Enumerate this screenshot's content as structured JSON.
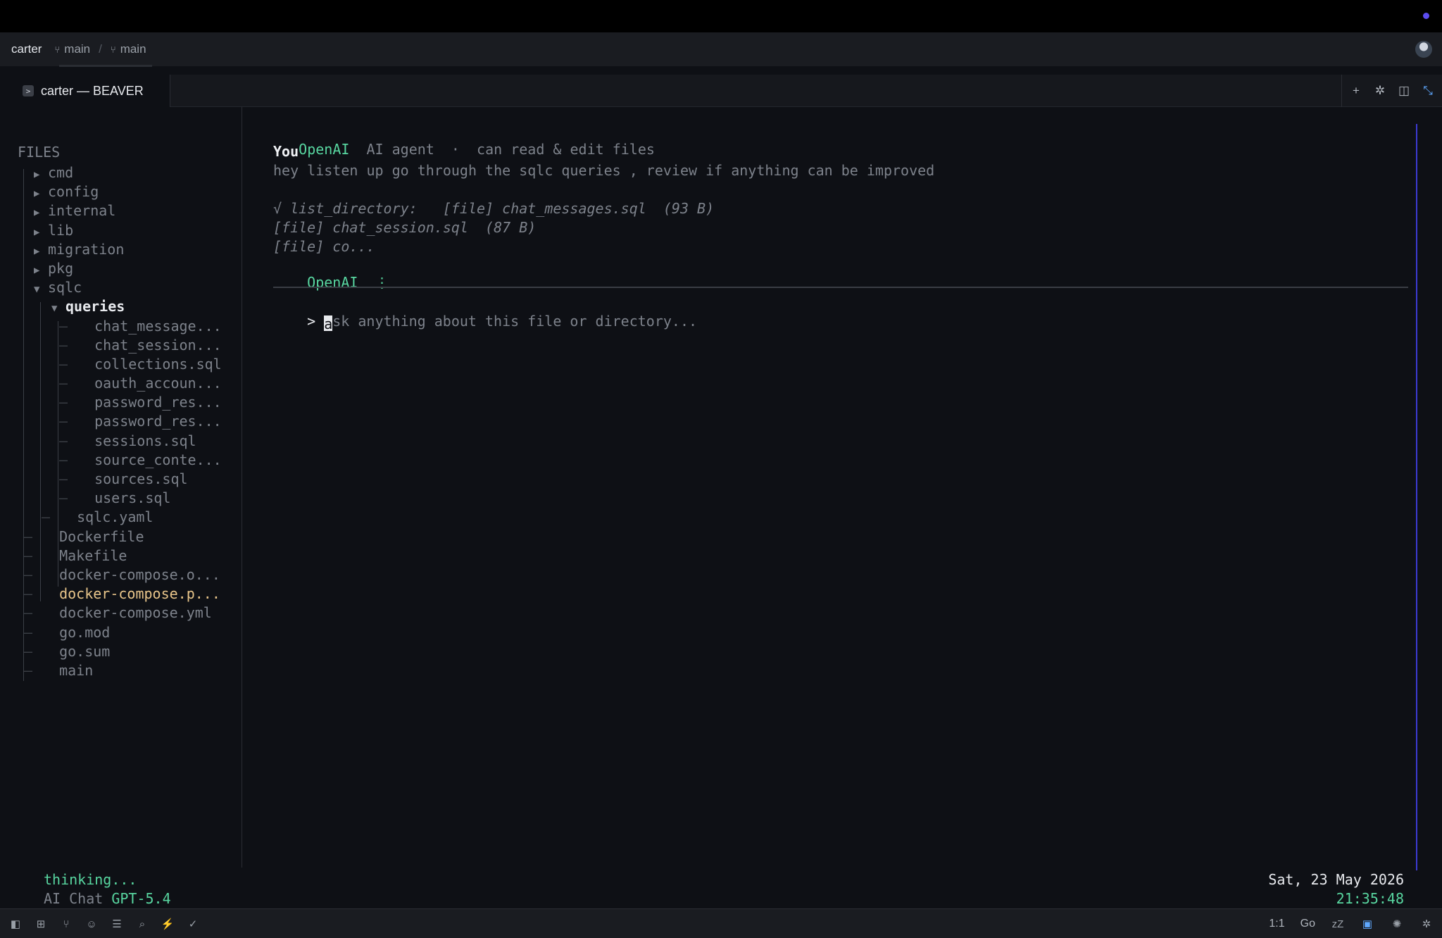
{
  "breadcrumb": {
    "user": "carter",
    "branch1": "main",
    "branch2": "main"
  },
  "tab": {
    "title": "carter — BEAVER"
  },
  "sidebar": {
    "title": "FILES",
    "items": [
      {
        "label": "cmd"
      },
      {
        "label": "config"
      },
      {
        "label": "internal"
      },
      {
        "label": "lib"
      },
      {
        "label": "migration"
      },
      {
        "label": "pkg"
      },
      {
        "label": "sqlc"
      },
      {
        "label": "queries"
      },
      {
        "label": "chat_message..."
      },
      {
        "label": "chat_session..."
      },
      {
        "label": "collections.sql"
      },
      {
        "label": "oauth_accoun..."
      },
      {
        "label": "password_res..."
      },
      {
        "label": "password_res..."
      },
      {
        "label": "sessions.sql"
      },
      {
        "label": "source_conte..."
      },
      {
        "label": "sources.sql"
      },
      {
        "label": "users.sql"
      },
      {
        "label": "sqlc.yaml"
      },
      {
        "label": "Dockerfile"
      },
      {
        "label": "Makefile"
      },
      {
        "label": "docker-compose.o..."
      },
      {
        "label": "docker-compose.p..."
      },
      {
        "label": "docker-compose.yml"
      },
      {
        "label": "go.mod"
      },
      {
        "label": "go.sum"
      },
      {
        "label": "main"
      }
    ]
  },
  "chat": {
    "agent_name": "OpenAI",
    "agent_desc": "AI agent  ·  can read & edit files",
    "you_label": "You",
    "user_message": "hey listen up go through the sqlc queries , review if anything can be improved",
    "tool_line1": "√ list_directory:   [file] chat_messages.sql  (93 B)",
    "tool_line2": "[file] chat_session.sql  (87 B)",
    "tool_line3": "[file] co...",
    "agent_label2": "OpenAI",
    "agent_dots": "⋮",
    "prompt_symbol": ">",
    "input_cursor_char": "a",
    "input_placeholder": "sk anything about this file or directory..."
  },
  "status": {
    "thinking": "thinking...",
    "mode": "AI Chat",
    "model": "GPT-5.4",
    "date": "Sat, 23 May 2026",
    "time": "21:35:48"
  },
  "bottombar": {
    "ratio": "1:1",
    "language": "Go"
  },
  "colors": {
    "accent_green": "#58d6a0",
    "accent_blue": "#3c3ad2",
    "highlight_yellow": "#e8c58a"
  }
}
